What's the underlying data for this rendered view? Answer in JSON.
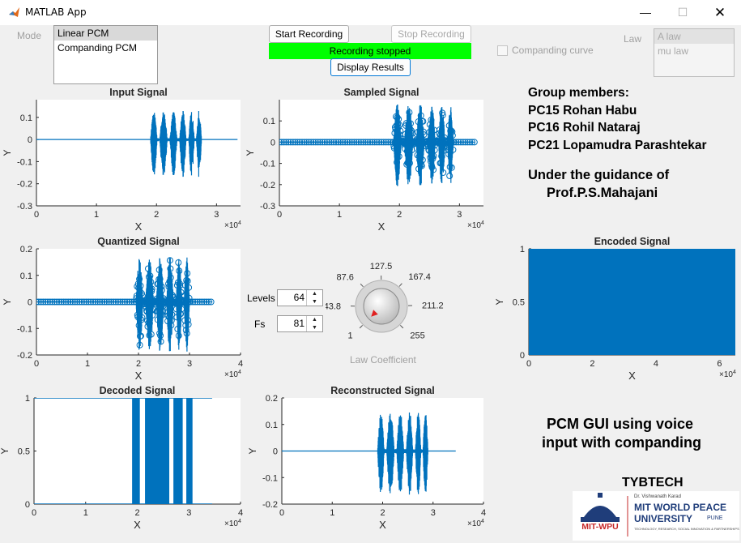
{
  "window": {
    "title": "MATLAB App"
  },
  "controls": {
    "mode_label": "Mode",
    "mode_options": [
      "Linear PCM",
      "Companding PCM"
    ],
    "mode_selected": "Linear PCM",
    "start_button": "Start Recording",
    "stop_button": "Stop Recording",
    "status": "Recording stopped",
    "display_button": "Display Results",
    "companding_checkbox": "Companding curve",
    "law_label": "Law",
    "law_options": [
      "A law",
      "mu law"
    ],
    "levels_label": "Levels",
    "levels_value": "64",
    "fs_label": "Fs",
    "fs_value": "81",
    "knob_label": "Law Coefficient",
    "knob_ticks": [
      "1",
      "43.8",
      "87.6",
      "127.5",
      "167.4",
      "211.2",
      "255"
    ],
    "knob_value": 1
  },
  "colors": {
    "plot": "#0072bd",
    "status_bg": "#00ff00",
    "knob_pointer": "#e02020"
  },
  "info": {
    "group_title": "Group members:",
    "members": [
      "PC15 Rohan Habu",
      "PC16 Rohil Nataraj",
      "PC21 Lopamudra Parashtekar"
    ],
    "guidance_line1": "Under the guidance of",
    "guidance_line2": "Prof.P.S.Mahajani",
    "project_title_line1": "PCM GUI using voice",
    "project_title_line2": "input with companding",
    "class_name": "TYBTECH"
  },
  "logo": {
    "short": "MIT-WPU",
    "prefix": "Dr. Vishwanath Karad",
    "name_line1": "MIT WORLD PEACE",
    "name_line2": "UNIVERSITY",
    "city": "PUNE",
    "tagline": "TECHNOLOGY, RESEARCH, SOCIAL INNOVATION & PARTNERSHIPS"
  },
  "chart_data": [
    {
      "type": "line",
      "title": "Input Signal",
      "xlabel": "X",
      "ylabel": "Y",
      "xlim": [
        0,
        34000
      ],
      "ylim": [
        -0.3,
        0.18
      ],
      "x_multiplier": "×10^4",
      "xticks": [
        "0",
        "1",
        "2",
        "3"
      ],
      "yticks": [
        "-0.3",
        "-0.2",
        "-0.1",
        "0",
        "0.1"
      ],
      "signal": {
        "start": 19000,
        "end": 27500,
        "peak": 0.13,
        "trough": -0.17,
        "tail_end": 33500
      }
    },
    {
      "type": "stem",
      "title": "Sampled Signal",
      "xlabel": "X",
      "ylabel": "Y",
      "xlim": [
        0,
        34000
      ],
      "ylim": [
        -0.3,
        0.2
      ],
      "x_multiplier": "×10^4",
      "xticks": [
        "0",
        "1",
        "2",
        "3"
      ],
      "yticks": [
        "-0.3",
        "-0.2",
        "-0.1",
        "0",
        "0.1"
      ],
      "signal": {
        "start": 19000,
        "end": 29000,
        "peak": 0.18,
        "trough": -0.21,
        "tail_end": 32500
      }
    },
    {
      "type": "stem",
      "title": "Quantized Signal",
      "xlabel": "X",
      "ylabel": "Y",
      "xlim": [
        0,
        40000
      ],
      "ylim": [
        -0.2,
        0.2
      ],
      "x_multiplier": "×10^4",
      "xticks": [
        "0",
        "1",
        "2",
        "3",
        "4"
      ],
      "yticks": [
        "-0.2",
        "-0.1",
        "0",
        "0.1",
        "0.2"
      ],
      "signal": {
        "start": 19500,
        "end": 30000,
        "peak": 0.17,
        "trough": -0.19,
        "tail_end": 34500
      }
    },
    {
      "type": "line",
      "title": "Encoded Signal",
      "xlabel": "X",
      "ylabel": "Y",
      "xlim": [
        0,
        65000
      ],
      "ylim": [
        0,
        1
      ],
      "x_multiplier": "×10^4",
      "xticks": [
        "0",
        "2",
        "4",
        "6"
      ],
      "yticks": [
        "0",
        "0.5",
        "1"
      ],
      "signal": {
        "fill": true
      }
    },
    {
      "type": "line",
      "title": "Decoded Signal",
      "xlabel": "X",
      "ylabel": "Y",
      "xlim": [
        0,
        40000
      ],
      "ylim": [
        0,
        1
      ],
      "x_multiplier": "×10^4",
      "xticks": [
        "0",
        "1",
        "2",
        "3",
        "4"
      ],
      "yticks": [
        "0",
        "0.5",
        "1"
      ],
      "signal": {
        "bands": [
          [
            19000,
            20500
          ],
          [
            21500,
            26200
          ],
          [
            27000,
            28800
          ],
          [
            29500,
            30700
          ]
        ],
        "end": 34500
      }
    },
    {
      "type": "line",
      "title": "Reconstructed Signal",
      "xlabel": "X",
      "ylabel": "Y",
      "xlim": [
        0,
        40000
      ],
      "ylim": [
        -0.2,
        0.2
      ],
      "x_multiplier": "×10^4",
      "xticks": [
        "0",
        "1",
        "2",
        "3",
        "4"
      ],
      "yticks": [
        "-0.2",
        "-0.1",
        "0",
        "0.1",
        "0.2"
      ],
      "signal": {
        "start": 19000,
        "end": 29000,
        "peak": 0.15,
        "trough": -0.17,
        "tail_end": 34500
      }
    }
  ]
}
